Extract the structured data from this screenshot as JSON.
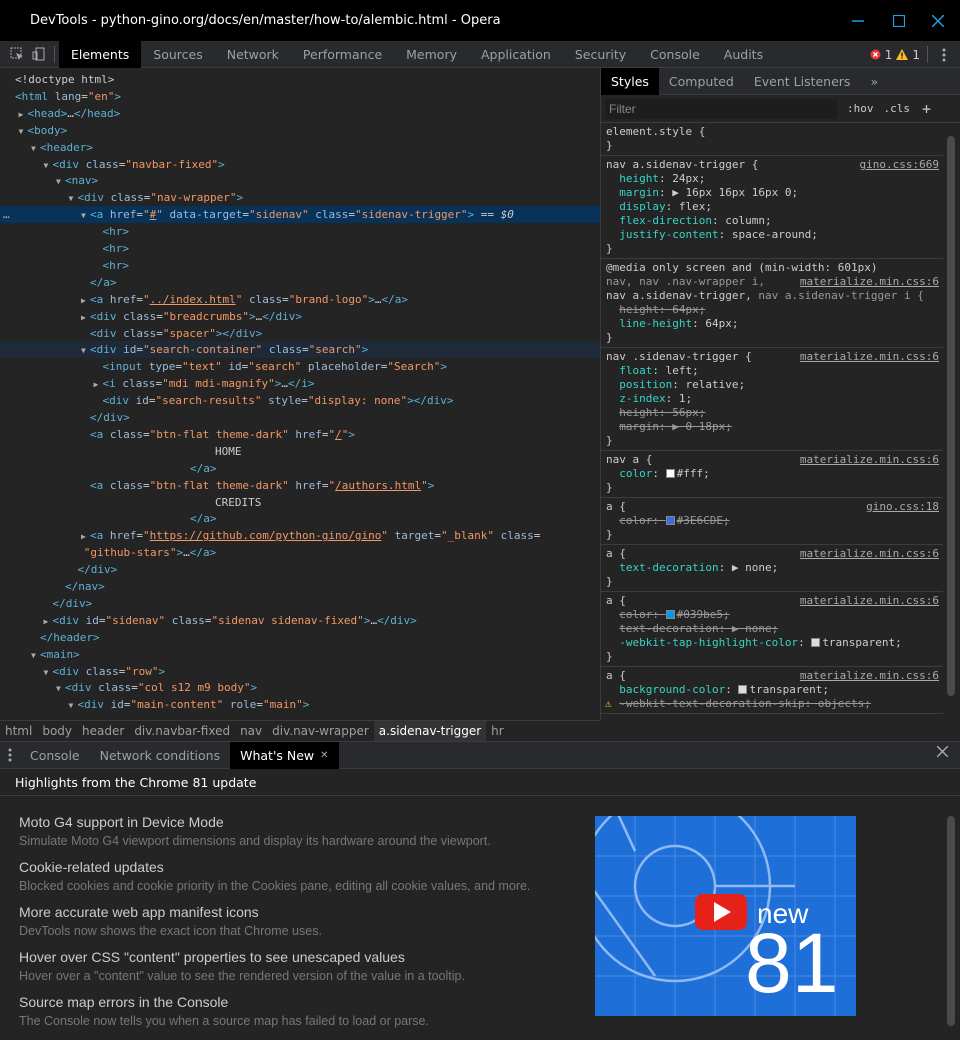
{
  "window": {
    "title": "DevTools - python-gino.org/docs/en/master/how-to/alembic.html - Opera"
  },
  "toolbar": {
    "tabs": [
      "Elements",
      "Sources",
      "Network",
      "Performance",
      "Memory",
      "Application",
      "Security",
      "Console",
      "Audits"
    ],
    "active_tab": "Elements",
    "error_count": "1",
    "warning_count": "1"
  },
  "elements_lines": [
    {
      "i": 0,
      "t": "",
      "h": "<span class='tx'>&lt;!doctype html&gt;</span>"
    },
    {
      "i": 0,
      "t": "",
      "h": "<span class='tag'>&lt;html</span> <span class='an'>lang</span>=<span class='av'>\"en\"</span><span class='tag'>&gt;</span>"
    },
    {
      "i": 1,
      "t": "▶",
      "h": "<span class='tag'>&lt;head&gt;</span>…<span class='tag'>&lt;/head&gt;</span>"
    },
    {
      "i": 1,
      "t": "▼",
      "h": "<span class='tag'>&lt;body&gt;</span>"
    },
    {
      "i": 2,
      "t": "▼",
      "h": "<span class='tag'>&lt;header&gt;</span>"
    },
    {
      "i": 3,
      "t": "▼",
      "h": "<span class='tag'>&lt;div</span> <span class='an'>class</span>=<span class='av'>\"navbar-fixed\"</span><span class='tag'>&gt;</span>"
    },
    {
      "i": 4,
      "t": "▼",
      "h": "<span class='tag'>&lt;nav&gt;</span>"
    },
    {
      "i": 5,
      "t": "▼",
      "h": "<span class='tag'>&lt;div</span> <span class='an'>class</span>=<span class='av'>\"nav-wrapper\"</span><span class='tag'>&gt;</span>"
    },
    {
      "i": 6,
      "t": "▼",
      "sel": true,
      "h": "<span class='tag'>&lt;a</span> <span class='an'>href</span>=<span class='av'>\"<u>#</u>\"</span> <span class='an'>data-target</span>=<span class='av'>\"sidenav\"</span> <span class='an'>class</span>=<span class='av'>\"sidenav-trigger\"</span><span class='tag'>&gt;</span> == <i>$0</i>"
    },
    {
      "i": 7,
      "t": "",
      "h": "<span class='tag'>&lt;hr&gt;</span>"
    },
    {
      "i": 7,
      "t": "",
      "h": "<span class='tag'>&lt;hr&gt;</span>"
    },
    {
      "i": 7,
      "t": "",
      "h": "<span class='tag'>&lt;hr&gt;</span>"
    },
    {
      "i": 6,
      "t": "",
      "h": "<span class='tag'>&lt;/a&gt;</span>"
    },
    {
      "i": 6,
      "t": "▶",
      "h": "<span class='tag'>&lt;a</span> <span class='an'>href</span>=<span class='av'>\"<u>../index.html</u>\"</span> <span class='an'>class</span>=<span class='av'>\"brand-logo\"</span><span class='tag'>&gt;</span>…<span class='tag'>&lt;/a&gt;</span>"
    },
    {
      "i": 6,
      "t": "▶",
      "h": "<span class='tag'>&lt;div</span> <span class='an'>class</span>=<span class='av'>\"breadcrumbs\"</span><span class='tag'>&gt;</span>…<span class='tag'>&lt;/div&gt;</span>"
    },
    {
      "i": 6,
      "t": "",
      "h": "<span class='tag'>&lt;div</span> <span class='an'>class</span>=<span class='av'>\"spacer\"</span><span class='tag'>&gt;&lt;/div&gt;</span>"
    },
    {
      "i": 6,
      "t": "▼",
      "hov": true,
      "h": "<span class='tag'>&lt;div</span> <span class='an'>id</span>=<span class='av'>\"search-container\"</span> <span class='an'>class</span>=<span class='av'>\"search\"</span><span class='tag'>&gt;</span>"
    },
    {
      "i": 7,
      "t": "",
      "h": "<span class='tag'>&lt;input</span> <span class='an'>type</span>=<span class='av'>\"text\"</span> <span class='an'>id</span>=<span class='av'>\"search\"</span> <span class='an'>placeholder</span>=<span class='av'>\"Search\"</span><span class='tag'>&gt;</span>"
    },
    {
      "i": 7,
      "t": "▶",
      "h": "<span class='tag'>&lt;i</span> <span class='an'>class</span>=<span class='av'>\"mdi mdi-magnify\"</span><span class='tag'>&gt;</span>…<span class='tag'>&lt;/i&gt;</span>"
    },
    {
      "i": 7,
      "t": "",
      "h": "<span class='tag'>&lt;div</span> <span class='an'>id</span>=<span class='av'>\"search-results\"</span> <span class='an'>style</span>=<span class='av'>\"display: none\"</span><span class='tag'>&gt;&lt;/div&gt;</span>"
    },
    {
      "i": 6,
      "t": "",
      "h": "<span class='tag'>&lt;/div&gt;</span>"
    },
    {
      "i": 6,
      "t": "",
      "h": "<span class='tag'>&lt;a</span> <span class='an'>class</span>=<span class='av'>\"btn-flat theme-dark\"</span> <span class='an'>href</span>=<span class='av'>\"<u>/</u>\"</span><span class='tag'>&gt;</span>"
    },
    {
      "i": 16,
      "t": "",
      "h": "<span class='tx'>HOME</span>"
    },
    {
      "i": 14,
      "t": "",
      "h": "<span class='tag'>&lt;/a&gt;</span>"
    },
    {
      "i": 6,
      "t": "",
      "h": "<span class='tag'>&lt;a</span> <span class='an'>class</span>=<span class='av'>\"btn-flat theme-dark\"</span> <span class='an'>href</span>=<span class='av'>\"<u>/authors.html</u>\"</span><span class='tag'>&gt;</span>"
    },
    {
      "i": 16,
      "t": "",
      "h": "<span class='tx'>CREDITS</span>"
    },
    {
      "i": 14,
      "t": "",
      "h": "<span class='tag'>&lt;/a&gt;</span>"
    },
    {
      "i": 6,
      "t": "▶",
      "h": "<span class='tag'>&lt;a</span> <span class='an'>href</span>=<span class='av'>\"<u>https://github.com/python-gino/gino</u>\"</span> <span class='an'>target</span>=<span class='av'>\"_blank\"</span> <span class='an'>class</span>="
    },
    {
      "i": 5.5,
      "t": "",
      "h": "<span class='av'>\"github-stars\"</span><span class='tag'>&gt;</span>…<span class='tag'>&lt;/a&gt;</span>"
    },
    {
      "i": 5,
      "t": "",
      "h": "<span class='tag'>&lt;/div&gt;</span>"
    },
    {
      "i": 4,
      "t": "",
      "h": "<span class='tag'>&lt;/nav&gt;</span>"
    },
    {
      "i": 3,
      "t": "",
      "h": "<span class='tag'>&lt;/div&gt;</span>"
    },
    {
      "i": 3,
      "t": "▶",
      "h": "<span class='tag'>&lt;div</span> <span class='an'>id</span>=<span class='av'>\"sidenav\"</span> <span class='an'>class</span>=<span class='av'>\"sidenav sidenav-fixed\"</span><span class='tag'>&gt;</span>…<span class='tag'>&lt;/div&gt;</span>"
    },
    {
      "i": 2,
      "t": "",
      "h": "<span class='tag'>&lt;/header&gt;</span>"
    },
    {
      "i": 2,
      "t": "▼",
      "h": "<span class='tag'>&lt;main&gt;</span>"
    },
    {
      "i": 3,
      "t": "▼",
      "h": "<span class='tag'>&lt;div</span> <span class='an'>class</span>=<span class='av'>\"row\"</span><span class='tag'>&gt;</span>"
    },
    {
      "i": 4,
      "t": "▼",
      "h": "<span class='tag'>&lt;div</span> <span class='an'>class</span>=<span class='av'>\"col s12 m9 body\"</span><span class='tag'>&gt;</span>"
    },
    {
      "i": 5,
      "t": "▼",
      "h": "<span class='tag'>&lt;div</span> <span class='an'>id</span>=<span class='av'>\"main-content\"</span> <span class='an'>role</span>=<span class='av'>\"main\"</span><span class='tag'>&gt;</span>"
    }
  ],
  "styles": {
    "tabs": [
      "Styles",
      "Computed",
      "Event Listeners"
    ],
    "more": "»",
    "filter_placeholder": "Filter",
    "hov": ":hov",
    "cls": ".cls",
    "plus": "+"
  },
  "style_rules": [
    {
      "lines": [
        "<span>element.style {</span>",
        "<span>}</span>"
      ]
    },
    {
      "src": "gino.css:669",
      "lines": [
        "<span>nav a.sidenav-trigger {</span>",
        "  <span class='prop'>height</span>: 24px;",
        "  <span class='prop'>margin</span>: ▶ 16px 16px 16px 0;",
        "  <span class='prop'>display</span>: flex;",
        "  <span class='prop'>flex-direction</span>: column;",
        "  <span class='prop'>justify-content</span>: space-around;",
        "}"
      ]
    },
    {
      "src2": "materialize.min.css:6",
      "lines": [
        "@media only screen and (min-width: 601px)",
        "<span style='color:#999'>nav, nav .nav-wrapper i,</span>",
        "nav a.sidenav-trigger, <span style='color:#999'>nav a.sidenav-trigger i {</span>",
        "  <span class='strike'><span class='prop'>height</span>: 64px;</span>",
        "  <span class='prop'>line-height</span>: 64px;",
        "}"
      ]
    },
    {
      "src": "materialize.min.css:6",
      "lines": [
        "nav .sidenav-trigger {",
        "  <span class='prop'>float</span>: left;",
        "  <span class='prop'>position</span>: relative;",
        "  <span class='prop'>z-index</span>: 1;",
        "  <span class='strike'><span class='prop'>height</span>: 56px;</span>",
        "  <span class='strike'><span class='prop'>margin</span>: ▶ 0 18px;</span>",
        "}"
      ]
    },
    {
      "src": "materialize.min.css:6",
      "lines": [
        "nav a {",
        "  <span class='prop'>color</span>: <span class='swatch' style='background:#fff'></span>#fff;",
        "}"
      ]
    },
    {
      "src": "gino.css:18",
      "lines": [
        "a {",
        "  <span class='strike'><span class='prop'>color</span>: <span class='swatch' style='background:#3E6CDE'></span>#3E6CDE;</span>",
        "}"
      ]
    },
    {
      "src": "materialize.min.css:6",
      "lines": [
        "a {",
        "  <span class='prop'>text-decoration</span>: ▶ none;",
        "}"
      ]
    },
    {
      "src": "materialize.min.css:6",
      "lines": [
        "a {",
        "  <span class='strike'><span class='prop'>color</span>: <span class='swatch' style='background:#039be5'></span>#039be5;</span>",
        "  <span class='strike'><span class='prop'>text-decoration</span>: ▶ none;</span>",
        "  <span class='prop'>-webkit-tap-highlight-color</span>: <span class='swatch' style='background:#ddd'></span>transparent;",
        "}"
      ]
    },
    {
      "src": "materialize.min.css:6",
      "lines": [
        "a {",
        "  <span class='prop'>background-color</span>: <span class='swatch' style='background:#ddd'></span>transparent;",
        "  <span class='strike'><span class='prop'>-webkit-text-decoration-skip</span>: objects;</span>"
      ]
    }
  ],
  "breadcrumbs": [
    "html",
    "body",
    "header",
    "div.navbar-fixed",
    "nav",
    "div.nav-wrapper",
    "a.sidenav-trigger",
    "hr"
  ],
  "active_crumb": "a.sidenav-trigger",
  "drawer": {
    "tabs": [
      "Console",
      "Network conditions",
      "What's New"
    ],
    "active": "What's New"
  },
  "whats_new": {
    "heading": "Highlights from the Chrome 81 update",
    "items": [
      {
        "title": "Moto G4 support in Device Mode",
        "desc": "Simulate Moto G4 viewport dimensions and display its hardware around the viewport."
      },
      {
        "title": "Cookie-related updates",
        "desc": "Blocked cookies and cookie priority in the Cookies pane, editing all cookie values, and more."
      },
      {
        "title": "More accurate web app manifest icons",
        "desc": "DevTools now shows the exact icon that Chrome uses."
      },
      {
        "title": "Hover over CSS \"content\" properties to see unescaped values",
        "desc": "Hover over a \"content\" value to see the rendered version of the value in a tooltip."
      },
      {
        "title": "Source map errors in the Console",
        "desc": "The Console now tells you when a source map has failed to load or parse."
      }
    ],
    "promo_new": "new",
    "promo_version": "81"
  }
}
